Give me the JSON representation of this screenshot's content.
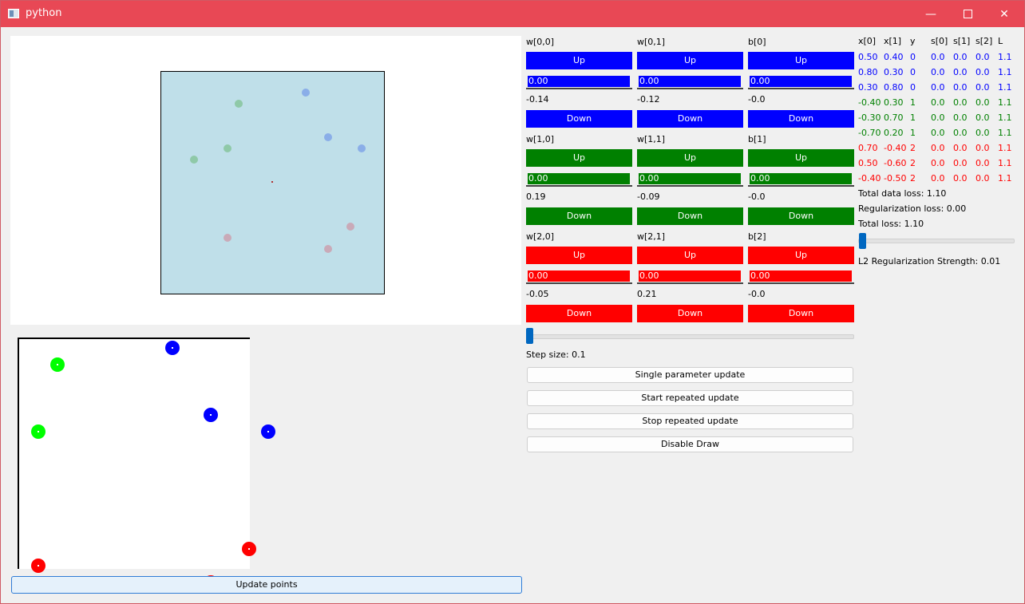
{
  "window": {
    "title": "python"
  },
  "params": [
    {
      "label": "w[0,0]",
      "up": "Up",
      "field": "0.00",
      "value": "-0.14",
      "down": "Down"
    },
    {
      "label": "w[0,1]",
      "up": "Up",
      "field": "0.00",
      "value": "-0.12",
      "down": "Down"
    },
    {
      "label": "b[0]",
      "up": "Up",
      "field": "0.00",
      "value": "-0.0",
      "down": "Down"
    },
    {
      "label": "w[1,0]",
      "up": "Up",
      "field": "0.00",
      "value": "0.19",
      "down": "Down"
    },
    {
      "label": "w[1,1]",
      "up": "Up",
      "field": "0.00",
      "value": "-0.09",
      "down": "Down"
    },
    {
      "label": "b[1]",
      "up": "Up",
      "field": "0.00",
      "value": "-0.0",
      "down": "Down"
    },
    {
      "label": "w[2,0]",
      "up": "Up",
      "field": "0.00",
      "value": "-0.05",
      "down": "Down"
    },
    {
      "label": "w[2,1]",
      "up": "Up",
      "field": "0.00",
      "value": "0.21",
      "down": "Down"
    },
    {
      "label": "b[2]",
      "up": "Up",
      "field": "0.00",
      "value": "-0.0",
      "down": "Down"
    }
  ],
  "row_colors": [
    "#0000ff",
    "#008000",
    "#ff0000"
  ],
  "step": {
    "label": "Step size: 0.1",
    "value": 0.1
  },
  "actions": {
    "single": "Single parameter update",
    "start": "Start repeated update",
    "stop": "Stop repeated update",
    "disable_draw": "Disable Draw"
  },
  "update_points": "Update points",
  "table": {
    "headers": [
      "x[0]",
      "x[1]",
      "y",
      "s[0]",
      "s[1]",
      "s[2]",
      "L"
    ],
    "rows": [
      {
        "cells": [
          "0.50",
          "0.40",
          "0",
          "0.0",
          "0.0",
          "0.0",
          "1.1"
        ],
        "color": "#0000ff"
      },
      {
        "cells": [
          "0.80",
          "0.30",
          "0",
          "0.0",
          "0.0",
          "0.0",
          "1.1"
        ],
        "color": "#0000ff"
      },
      {
        "cells": [
          "0.30",
          "0.80",
          "0",
          "0.0",
          "0.0",
          "0.0",
          "1.1"
        ],
        "color": "#0000ff"
      },
      {
        "cells": [
          "-0.40",
          "0.30",
          "1",
          "0.0",
          "0.0",
          "0.0",
          "1.1"
        ],
        "color": "#008000"
      },
      {
        "cells": [
          "-0.30",
          "0.70",
          "1",
          "0.0",
          "0.0",
          "0.0",
          "1.1"
        ],
        "color": "#008000"
      },
      {
        "cells": [
          "-0.70",
          "0.20",
          "1",
          "0.0",
          "0.0",
          "0.0",
          "1.1"
        ],
        "color": "#008000"
      },
      {
        "cells": [
          "0.70",
          "-0.40",
          "2",
          "0.0",
          "0.0",
          "0.0",
          "1.1"
        ],
        "color": "#ff0000"
      },
      {
        "cells": [
          "0.50",
          "-0.60",
          "2",
          "0.0",
          "0.0",
          "0.0",
          "1.1"
        ],
        "color": "#ff0000"
      },
      {
        "cells": [
          "-0.40",
          "-0.50",
          "2",
          "0.0",
          "0.0",
          "0.0",
          "1.1"
        ],
        "color": "#ff0000"
      }
    ]
  },
  "loss": {
    "data_loss": "Total data loss: 1.10",
    "reg_loss": "Regularization loss: 0.00",
    "total_loss": "Total loss: 1.10",
    "l2_label": "L2 Regularization Strength: 0.01",
    "l2_value": 0.01
  },
  "classes": [
    {
      "label": "0",
      "dot": "#0000ff",
      "pt": "#8aaee8"
    },
    {
      "label": "1",
      "dot": "#00ff00",
      "pt": "#8fc9a8"
    },
    {
      "label": "2",
      "dot": "#ff0000",
      "pt": "#c9aab8"
    }
  ]
}
